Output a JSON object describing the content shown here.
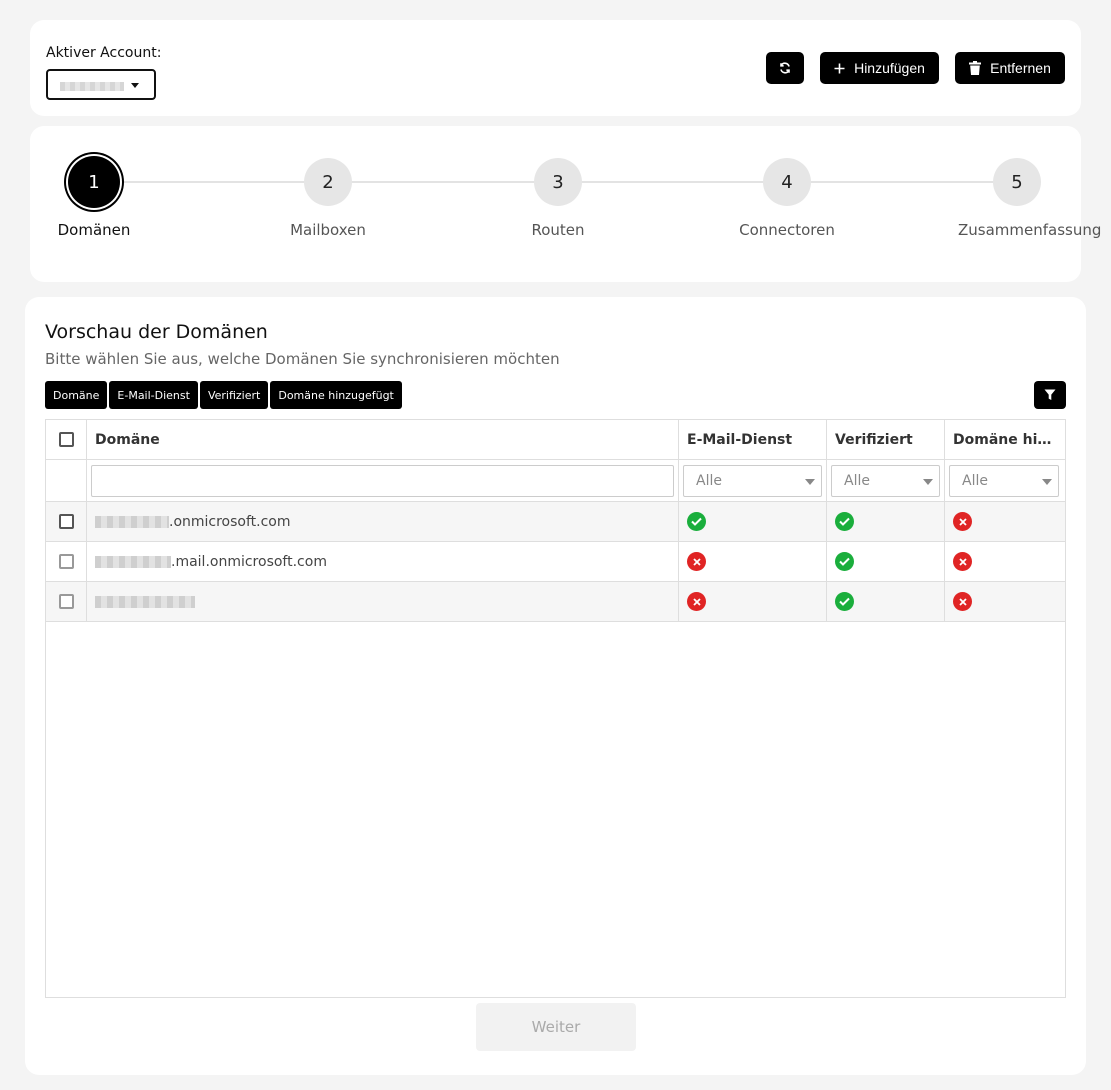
{
  "account": {
    "label": "Aktiver Account:",
    "selected_value": "",
    "refresh_icon": "refresh-icon",
    "add_label": "Hinzufügen",
    "remove_label": "Entfernen"
  },
  "stepper": {
    "steps": [
      {
        "number": "1",
        "label": "Domänen",
        "active": true
      },
      {
        "number": "2",
        "label": "Mailboxen",
        "active": false
      },
      {
        "number": "3",
        "label": "Routen",
        "active": false
      },
      {
        "number": "4",
        "label": "Connectoren",
        "active": false
      },
      {
        "number": "5",
        "label": "Zusammenfassung",
        "active": false
      }
    ]
  },
  "main": {
    "title": "Vorschau der Domänen",
    "subtitle": "Bitte wählen Sie aus, welche Domänen Sie synchronisieren möchten",
    "column_chips": [
      "Domäne",
      "E-Mail-Dienst",
      "Verifiziert",
      "Domäne hinzugefügt"
    ],
    "filter_icon": "filter-icon",
    "table": {
      "columns": [
        "Domäne",
        "E-Mail-Dienst",
        "Verifiziert",
        "Domäne hinzugefügt"
      ],
      "filters": {
        "domain_value": "",
        "mail_service": "Alle",
        "verified": "Alle",
        "added": "Alle"
      },
      "rows": [
        {
          "domain": ".onmicrosoft.com",
          "mail_service": false,
          "verified": true,
          "added": false
        },
        {
          "domain": ".mail.onmicrosoft.com",
          "mail_service": false,
          "verified": true,
          "added": false
        },
        {
          "domain": "",
          "mail_service": false,
          "verified": true,
          "added": false
        }
      ]
    },
    "next_label": "Weiter"
  },
  "colors": {
    "primary": "#000000",
    "success": "#1aae3c",
    "error": "#e02424",
    "background": "#f4f4f4"
  }
}
